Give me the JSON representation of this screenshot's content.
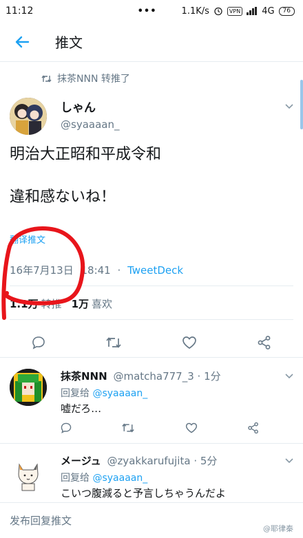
{
  "status_bar": {
    "time": "11:12",
    "dots": "•••",
    "net_speed": "1.1K/s",
    "vpn": "VPN",
    "network": "4G",
    "battery": "76"
  },
  "app_bar": {
    "title": "推文"
  },
  "retweet_line": {
    "text": "抹茶NNN 转推了"
  },
  "tweet": {
    "name": "しゃん",
    "handle": "@syaaaan_",
    "line1": "明治大正昭和平成令和",
    "line2": "違和感ないね！",
    "translate": "翻译推文",
    "date": "16年7月13日",
    "time": "18:41",
    "separator": "·",
    "source": "TweetDeck",
    "retweet_count": "1.1万",
    "retweet_label": "转推",
    "like_count": "1万",
    "like_label": "喜欢"
  },
  "replies": [
    {
      "name": "抹茶NNN",
      "handle": "@matcha777_3",
      "time": "· 1分",
      "reply_to_label": "回复给",
      "reply_to": "@syaaaan_",
      "body": "嘘だろ…"
    },
    {
      "name": "メージュ",
      "handle": "@zyakkarufujita",
      "time": "· 5分",
      "reply_to_label": "回复给",
      "reply_to": "@syaaaan_",
      "body": "こいつ腹減ると予言しちゃうんだよ"
    }
  ],
  "compose": {
    "placeholder": "发布回复推文"
  },
  "watermark": "@耶律秦",
  "colors": {
    "accent": "#1da1f2",
    "secondary_text": "#657786",
    "annotation": "#e8151b"
  }
}
